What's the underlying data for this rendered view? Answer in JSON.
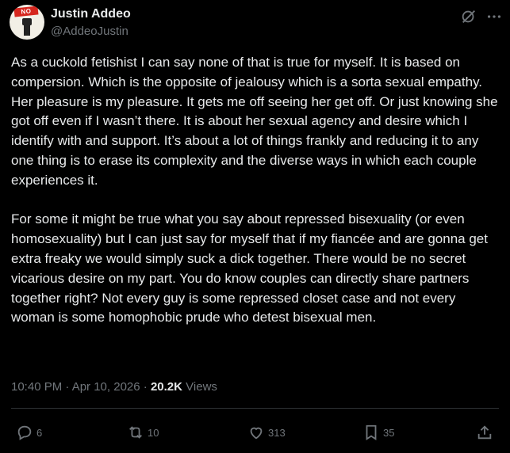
{
  "author": {
    "name": "Justin Addeo",
    "handle": "@AddeoJustin",
    "avatar_badge": "NO ICE"
  },
  "tweet": {
    "paragraphs": [
      "As a cuckold fetishist I can say none of that is true for myself. It is based on compersion. Which is the opposite of jealousy which is a sorta sexual empathy. Her pleasure is my pleasure. It gets me off seeing her get off. Or just knowing she got off even if I wasn’t there. It is about her sexual agency and desire which I identify with and support. It’s about a lot of things frankly and reducing it to any one thing is to erase its complexity and the diverse ways in which each couple experiences it.",
      "For some it might be true what you say about repressed bisexuality (or even homosexuality) but I can just say for myself that if my fiancée and are gonna get extra freaky we would simply suck a dick together. There would be no secret vicarious desire on my part. You do know couples can directly share partners together right? Not every guy is some repressed closet case and not every woman is some homophobic prude who detest bisexual men."
    ]
  },
  "meta": {
    "timestamp": "10:40 PM · Apr 10, 2026",
    "separator": " · ",
    "views_count": "20.2K",
    "views_label": "Views"
  },
  "actions": {
    "replies": "6",
    "reposts": "10",
    "likes": "313",
    "bookmarks": "35"
  },
  "colors": {
    "background": "#000000",
    "text": "#e7e9ea",
    "muted": "#71767b",
    "divider": "#2f3336"
  }
}
